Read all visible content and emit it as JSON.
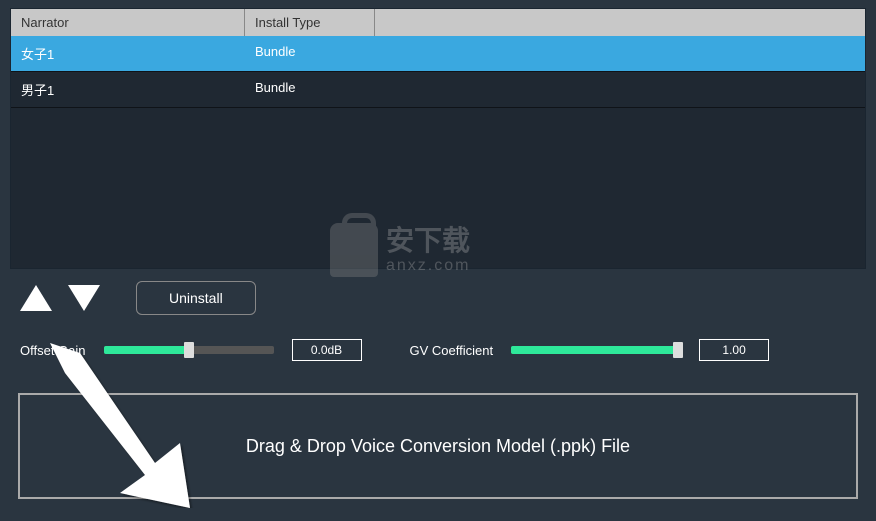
{
  "table": {
    "headers": {
      "narrator": "Narrator",
      "install_type": "Install Type"
    },
    "rows": [
      {
        "narrator": "女子1",
        "type": "Bundle",
        "selected": true
      },
      {
        "narrator": "男子1",
        "type": "Bundle",
        "selected": false
      }
    ]
  },
  "buttons": {
    "uninstall": "Uninstall"
  },
  "sliders": {
    "offset_gain": {
      "label": "Offset Gain",
      "value": "0.0dB"
    },
    "gv_coefficient": {
      "label": "GV Coefficient",
      "value": "1.00"
    }
  },
  "drop_zone": {
    "text": "Drag & Drop Voice Conversion Model (.ppk) File"
  },
  "watermark": {
    "cn": "安下载",
    "url": "anxz.com"
  }
}
